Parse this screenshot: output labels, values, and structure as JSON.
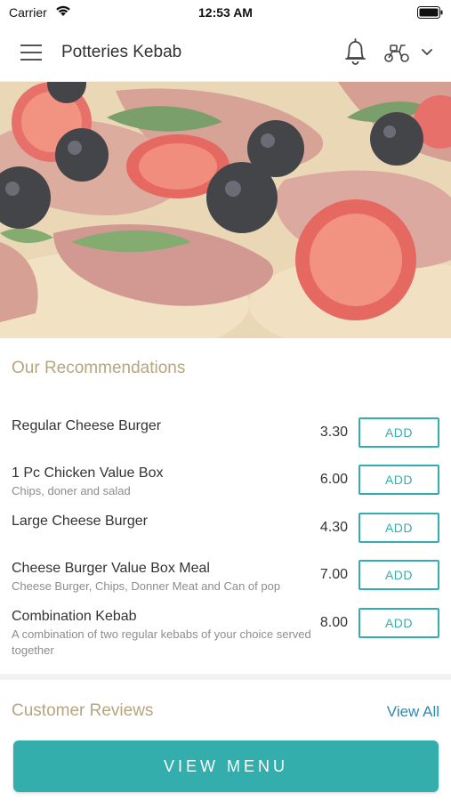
{
  "status_bar": {
    "carrier": "Carrier",
    "time": "12:53 AM"
  },
  "header": {
    "title": "Potteries Kebab",
    "icons": [
      "menu-icon",
      "bell-icon",
      "scooter-icon",
      "chevron-down-icon"
    ]
  },
  "hero": {
    "image": "pizza with tomatoes, black olives and cured ham"
  },
  "recommendations": {
    "heading": "Our Recommendations",
    "add_label": "ADD",
    "items": [
      {
        "name": "Regular Cheese Burger",
        "description": "",
        "price": "3.30"
      },
      {
        "name": "1 Pc Chicken Value Box",
        "description": "Chips, doner and salad",
        "price": "6.00"
      },
      {
        "name": "Large Cheese Burger",
        "description": "",
        "price": "4.30"
      },
      {
        "name": "Cheese Burger Value Box Meal",
        "description": "Cheese Burger, Chips, Donner Meat and Can of pop",
        "price": "7.00"
      },
      {
        "name": "Combination Kebab",
        "description": "A combination of two regular kebabs of your choice served together",
        "price": "8.00"
      }
    ]
  },
  "reviews": {
    "heading": "Customer Reviews",
    "view_all_label": "View All"
  },
  "footer": {
    "view_menu_label": "VIEW MENU"
  },
  "colors": {
    "accent": "#34aead",
    "heading_gold": "#b5a67f",
    "link_blue": "#2f89b3"
  }
}
